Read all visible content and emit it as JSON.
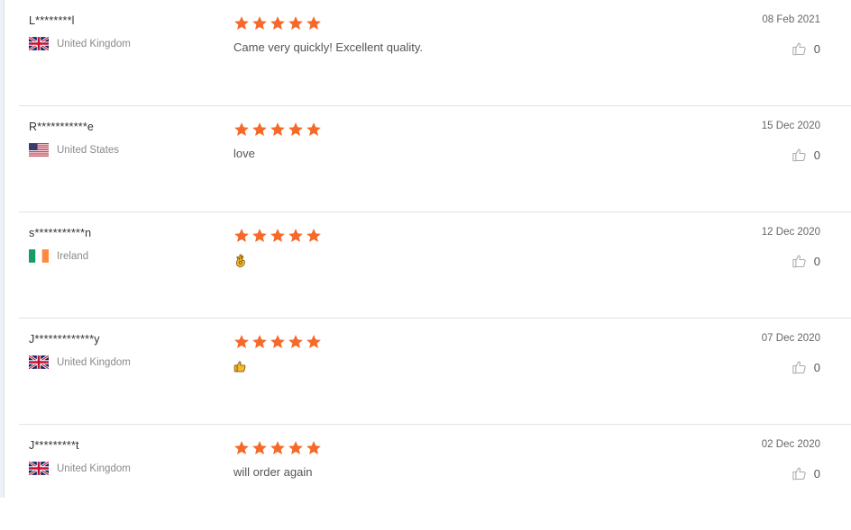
{
  "reviews": [
    {
      "user": "L********l",
      "country": "United Kingdom",
      "flag": "uk-flag",
      "stars": 5,
      "text": "Came very quickly! Excellent quality.",
      "emoji": null,
      "date": "08 Feb 2021",
      "helpful_count": "0"
    },
    {
      "user": "R***********e",
      "country": "United States",
      "flag": "us-flag",
      "stars": 5,
      "text": "love",
      "emoji": null,
      "date": "15 Dec 2020",
      "helpful_count": "0"
    },
    {
      "user": "s***********n",
      "country": "Ireland",
      "flag": "ireland-flag",
      "stars": 5,
      "text": "",
      "emoji": "ok-hand-emoji",
      "date": "12 Dec 2020",
      "helpful_count": "0"
    },
    {
      "user": "J*************y",
      "country": "United Kingdom",
      "flag": "uk-flag",
      "stars": 5,
      "text": "",
      "emoji": "thumbs-up-emoji",
      "date": "07 Dec 2020",
      "helpful_count": "0"
    },
    {
      "user": "J*********t",
      "country": "United Kingdom",
      "flag": "uk-flag",
      "stars": 5,
      "text": "will order again",
      "emoji": null,
      "date": "02 Dec 2020",
      "helpful_count": "0"
    }
  ],
  "colors": {
    "star": "#f5692a",
    "divider": "#e3e3e3",
    "muted_text": "#8a8a8a"
  }
}
